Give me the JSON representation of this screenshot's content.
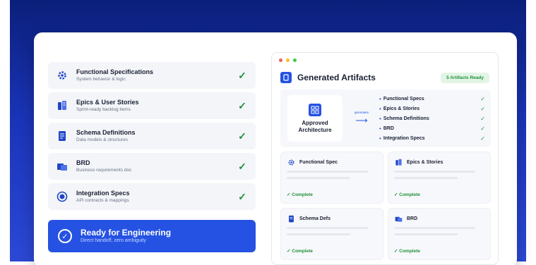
{
  "colors": {
    "accent": "#2552e3",
    "success": "#1f8f3a",
    "background_top": "#0b1f7a"
  },
  "specs": [
    {
      "title": "Functional Specifications",
      "subtitle": "System behavior & logic",
      "icon": "gear-icon"
    },
    {
      "title": "Epics & User Stories",
      "subtitle": "Sprint-ready backlog items",
      "icon": "stack-icon"
    },
    {
      "title": "Schema Definitions",
      "subtitle": "Data models & structures",
      "icon": "document-icon"
    },
    {
      "title": "BRD",
      "subtitle": "Business requirements doc",
      "icon": "folder-icon"
    },
    {
      "title": "Integration Specs",
      "subtitle": "API contracts & mappings",
      "icon": "target-icon"
    }
  ],
  "ready": {
    "title": "Ready for Engineering",
    "subtitle": "Direct handoff, zero ambiguity"
  },
  "panel": {
    "title": "Generated Artifacts",
    "badge": "5 Artifacts Ready",
    "source": "Approved Architecture",
    "connector": "generates",
    "outputs": [
      "Functional Specs",
      "Epics & Stories",
      "Schema Definitions",
      "BRD",
      "Integration Specs"
    ],
    "tiles": [
      {
        "title": "Functional Spec",
        "status": "✓ Complete",
        "icon": "gear-icon"
      },
      {
        "title": "Epics & Stories",
        "status": "✓ Complete",
        "icon": "stack-icon"
      },
      {
        "title": "Schema Defs",
        "status": "✓ Complete",
        "icon": "document-icon"
      },
      {
        "title": "BRD",
        "status": "✓ Complete",
        "icon": "folder-icon"
      }
    ]
  }
}
